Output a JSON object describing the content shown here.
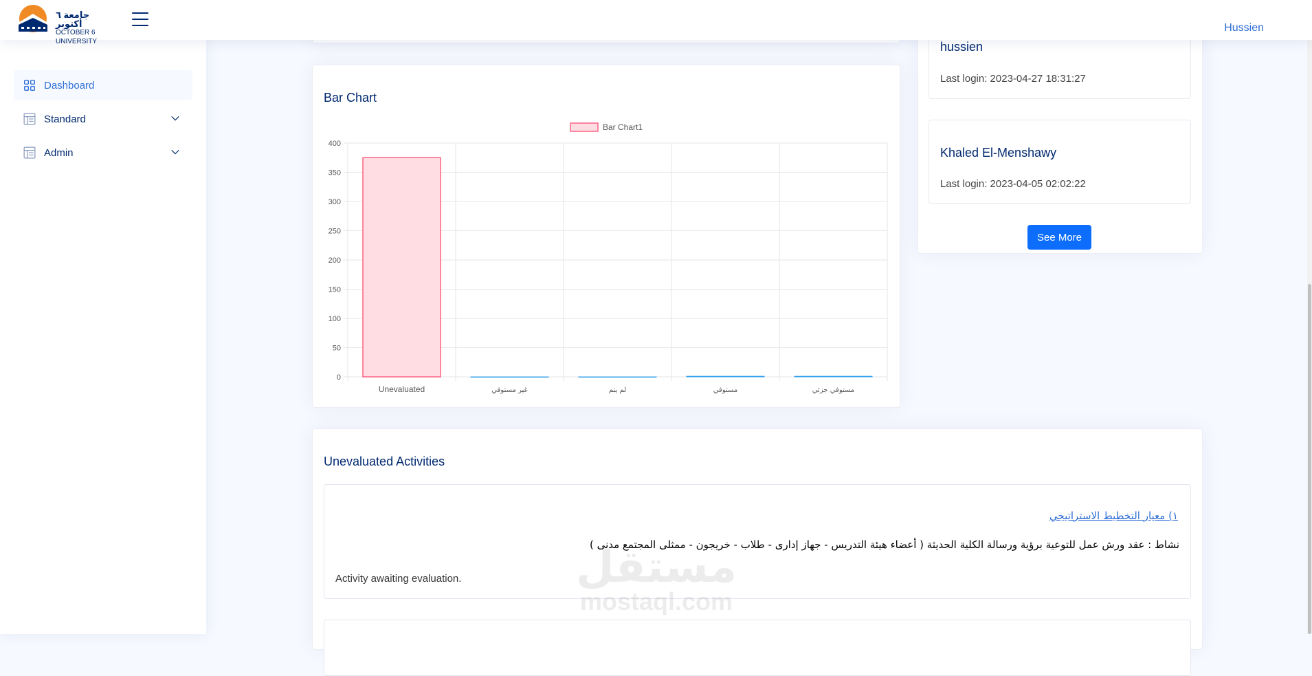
{
  "header": {
    "logo_ar": "جامعة ٦ أكتوبر",
    "logo_en": "OCTOBER 6 UNIVERSITY",
    "user_name": "Hussien"
  },
  "sidebar": {
    "items": [
      {
        "label": "Dashboard",
        "icon": "grid-icon"
      },
      {
        "label": "Standard",
        "icon": "layout-text-icon"
      },
      {
        "label": "Admin",
        "icon": "layout-text-icon"
      }
    ]
  },
  "chart_card": {
    "title": "Bar Chart"
  },
  "chart_data": {
    "type": "bar",
    "categories": [
      "Unevaluated",
      "غير مستوفي",
      "لم يتم",
      "مستوفي",
      "مستوفي جزئي"
    ],
    "series": [
      {
        "name": "Bar Chart1",
        "values": [
          375,
          0,
          0,
          1,
          1
        ]
      }
    ],
    "ylim": [
      0,
      400
    ],
    "yticks": [
      0,
      50,
      100,
      150,
      200,
      250,
      300,
      350,
      400
    ],
    "grid": true,
    "legend": "top-center",
    "colors": {
      "fill": "#ffdde3",
      "stroke": "#ff6384",
      "secondary_stroke": "#36a2eb"
    }
  },
  "recent_users": {
    "users": [
      {
        "name": "hussien",
        "last_login": "Last login: 2023-04-27 18:31:27"
      },
      {
        "name": "Khaled El-Menshawy",
        "last_login": "Last login: 2023-04-05 02:02:22"
      }
    ],
    "see_more_label": "See More"
  },
  "activities": {
    "title": "Unevaluated Activities",
    "items": [
      {
        "standard_link": "١) معيار التخطيط الاستراتيجي",
        "description": "نشاط : عقد ورش عمل للتوعية برؤية ورسالة الكلية الحديثة ( أعضاء هيئة التدريس - جهاز إدارى - طلاب - خريجون - ممثلى المجتمع مدنى )",
        "status": "Activity awaiting evaluation."
      }
    ]
  },
  "watermark": {
    "ar": "مستقل",
    "en": "mostaql.com"
  }
}
